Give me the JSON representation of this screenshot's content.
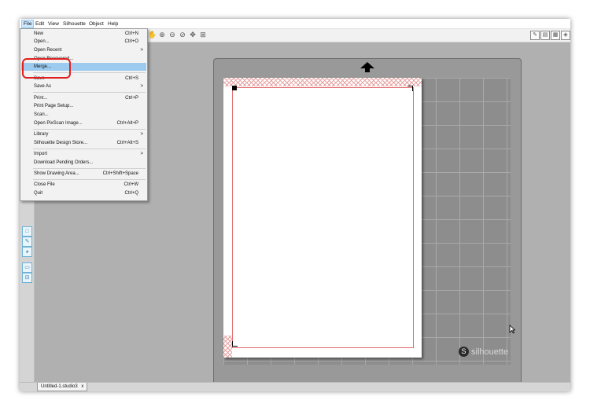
{
  "menubar": {
    "items": [
      "File",
      "Edit",
      "View",
      "Silhouette",
      "Object",
      "Help"
    ]
  },
  "file_menu": {
    "items": [
      {
        "label": "New",
        "shortcut": "Ctrl+N"
      },
      {
        "label": "Open...",
        "shortcut": "Ctrl+O"
      },
      {
        "label": "Open Recent",
        "submenu": ">"
      },
      {
        "label": "Open Recovered...",
        "shortcut": ""
      },
      {
        "label": "Merge...",
        "shortcut": ""
      },
      {
        "label": "Save",
        "shortcut": "Ctrl+S"
      },
      {
        "label": "Save As",
        "submenu": ">"
      },
      {
        "label": "Print...",
        "shortcut": "Ctrl+P"
      },
      {
        "label": "Print Page Setup...",
        "shortcut": ""
      },
      {
        "label": "Scan...",
        "shortcut": ""
      },
      {
        "label": "Open PixScan Image...",
        "shortcut": "Ctrl+Alt+P"
      },
      {
        "label": "Library",
        "submenu": ">"
      },
      {
        "label": "Silhouette Design Store...",
        "shortcut": "Ctrl+Alt+S"
      },
      {
        "label": "Import",
        "submenu": ">"
      },
      {
        "label": "Download Pending Orders...",
        "shortcut": ""
      },
      {
        "label": "Show Drawing Area...",
        "shortcut": "Ctrl+Shift+Space"
      },
      {
        "label": "Close File",
        "shortcut": "Ctrl+W"
      },
      {
        "label": "Quit",
        "shortcut": "Ctrl+Q"
      }
    ]
  },
  "toolbar": {
    "icons": [
      "pan-hand-icon",
      "zoom-in-icon",
      "zoom-out-icon",
      "zoom-select-icon",
      "drag-zoom-icon",
      "fit-to-page-icon"
    ],
    "right_icons": [
      "design-page-icon",
      "send-icon",
      "library-icon",
      "store-icon"
    ]
  },
  "canvas": {
    "logo_text": "silhouette",
    "logo_mark": "S"
  },
  "tabs": {
    "document": "Untitled-1.studio3",
    "close": "x"
  },
  "colors": {
    "highlight": "#9ccbef",
    "annotation": "#e02020",
    "cut_line": "#e36a6a"
  }
}
